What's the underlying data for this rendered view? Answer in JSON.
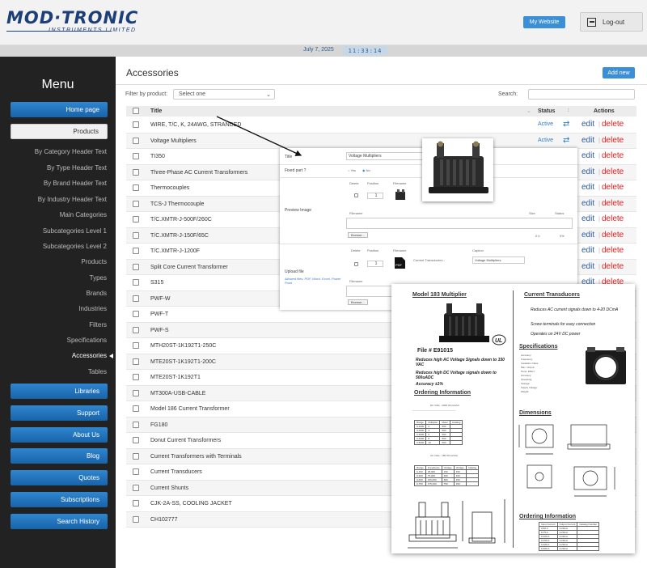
{
  "header": {
    "logo_main": "MOD·TRONIC",
    "logo_sub": "INSTRUMENTS LIMITED",
    "website_label": "My Website",
    "logout_label": "Log-out",
    "logout_icon": "logout-icon"
  },
  "datebar": {
    "date": "July 7, 2025",
    "time": "11:33:14"
  },
  "sidebar": {
    "title": "Menu",
    "home": "Home page",
    "products": "Products",
    "links": [
      "By Category Header Text",
      "By Type Header Text",
      "By Brand Header Text",
      "By Industry Header Text",
      "Main Categories",
      "Subcategories Level 1",
      "Subcategories Level 2",
      "Products",
      "Types",
      "Brands",
      "Industries",
      "Filters",
      "Specifications",
      "Accessories",
      "Tables"
    ],
    "buttons": [
      "Libraries",
      "Support",
      "About Us",
      "Blog",
      "Quotes",
      "Subscriptions",
      "Search History"
    ]
  },
  "main": {
    "title": "Accessories",
    "add_new": "Add new",
    "filter_label": "Filter by product:",
    "filter_value": "Select one",
    "search_label": "Search:",
    "columns": {
      "title": "Title",
      "status": "Status",
      "actions": "Actions"
    },
    "edit_label": "edit",
    "delete_label": "delete",
    "separator": "|",
    "rows": [
      {
        "title": "WIRE, T/C, K, 24AWG, STRANDED",
        "status": "Active"
      },
      {
        "title": "Voltage Multipliers",
        "status": "Active"
      },
      {
        "title": "TI350",
        "status": ""
      },
      {
        "title": "Three-Phase AC Current Transformers",
        "status": ""
      },
      {
        "title": "Thermocouples",
        "status": ""
      },
      {
        "title": "TCS-J Thermocouple",
        "status": ""
      },
      {
        "title": "T/C.XMTR-J-500F/260C",
        "status": ""
      },
      {
        "title": "T/C.XMTR-J-150F/65C",
        "status": ""
      },
      {
        "title": "T/C.XMTR-J-1200F",
        "status": ""
      },
      {
        "title": "Split Core Current Transformer",
        "status": ""
      },
      {
        "title": "S315",
        "status": ""
      },
      {
        "title": "PWF-W",
        "status": ""
      },
      {
        "title": "PWF-T",
        "status": ""
      },
      {
        "title": "PWF-S",
        "status": ""
      },
      {
        "title": "MTH20ST-1K192T1-250C",
        "status": ""
      },
      {
        "title": "MTE20ST-1K192T1-200C",
        "status": ""
      },
      {
        "title": "MTE20ST-1K192T1",
        "status": ""
      },
      {
        "title": "MT300A-USB-CABLE",
        "status": ""
      },
      {
        "title": "Model 186 Current Transformer",
        "status": ""
      },
      {
        "title": "FG180",
        "status": ""
      },
      {
        "title": "Donut Current Transformers",
        "status": ""
      },
      {
        "title": "Current Transformers with Terminals",
        "status": ""
      },
      {
        "title": "Current Transducers",
        "status": ""
      },
      {
        "title": "Current Shunts",
        "status": ""
      },
      {
        "title": "CJK-2A-SS, COOLING JACKET",
        "status": ""
      },
      {
        "title": "CH102777",
        "status": ""
      }
    ]
  },
  "panel": {
    "title_label": "Title",
    "title_value": "Voltage Multipliers",
    "fixed_label": "Fixed part ?",
    "yes": "Yes",
    "no": "No",
    "preview_label": "Preview Image",
    "delete_col": "Delete",
    "position_col": "Position",
    "filename_col": "Filename",
    "size_col": "Size",
    "status_col": "Status",
    "caption_col": "Caption",
    "position_value": "1",
    "browse": "Browse...",
    "size_value": "0 b",
    "status_value": "0%",
    "upload_label": "Upload file",
    "allowed": "Allowed files: PDF, Word, Excel, Power Point",
    "file_title": "Current Transducers -",
    "caption_value": "Voltage Multipliers"
  },
  "pdf": {
    "left_heading": "Model 183 Multiplier",
    "file_no": "File # E91015",
    "bullets": [
      "Reduces high AC Voltage Signals down to 150 VAC",
      "Reduces high DC Voltage signals down to 500uADC",
      "Accuracy ±1%"
    ],
    "ordering": "Ordering Information",
    "dc_title": "DC Volts - 2000 Ohms/Volt",
    "ac_title": "AC Volts - 185 Ohms/Volt",
    "right_heading": "Current Transducers",
    "r_bullets": [
      "Reduces AC current signals down to 4-20 DCmA",
      "Screw terminals for easy connection",
      "Operates on 24V DC power"
    ],
    "specs": "Specifications",
    "spec_lines": [
      "Accuracy:",
      "Frequency:",
      "Insulation Class:",
      "Max. Output:",
      "Temp. Effect:",
      "Accuracy:",
      "Operating:",
      "Storage:",
      "Supply Voltage:",
      "Weight:"
    ],
    "dimensions": "Dimensions",
    "ordering2": "Ordering Information"
  }
}
